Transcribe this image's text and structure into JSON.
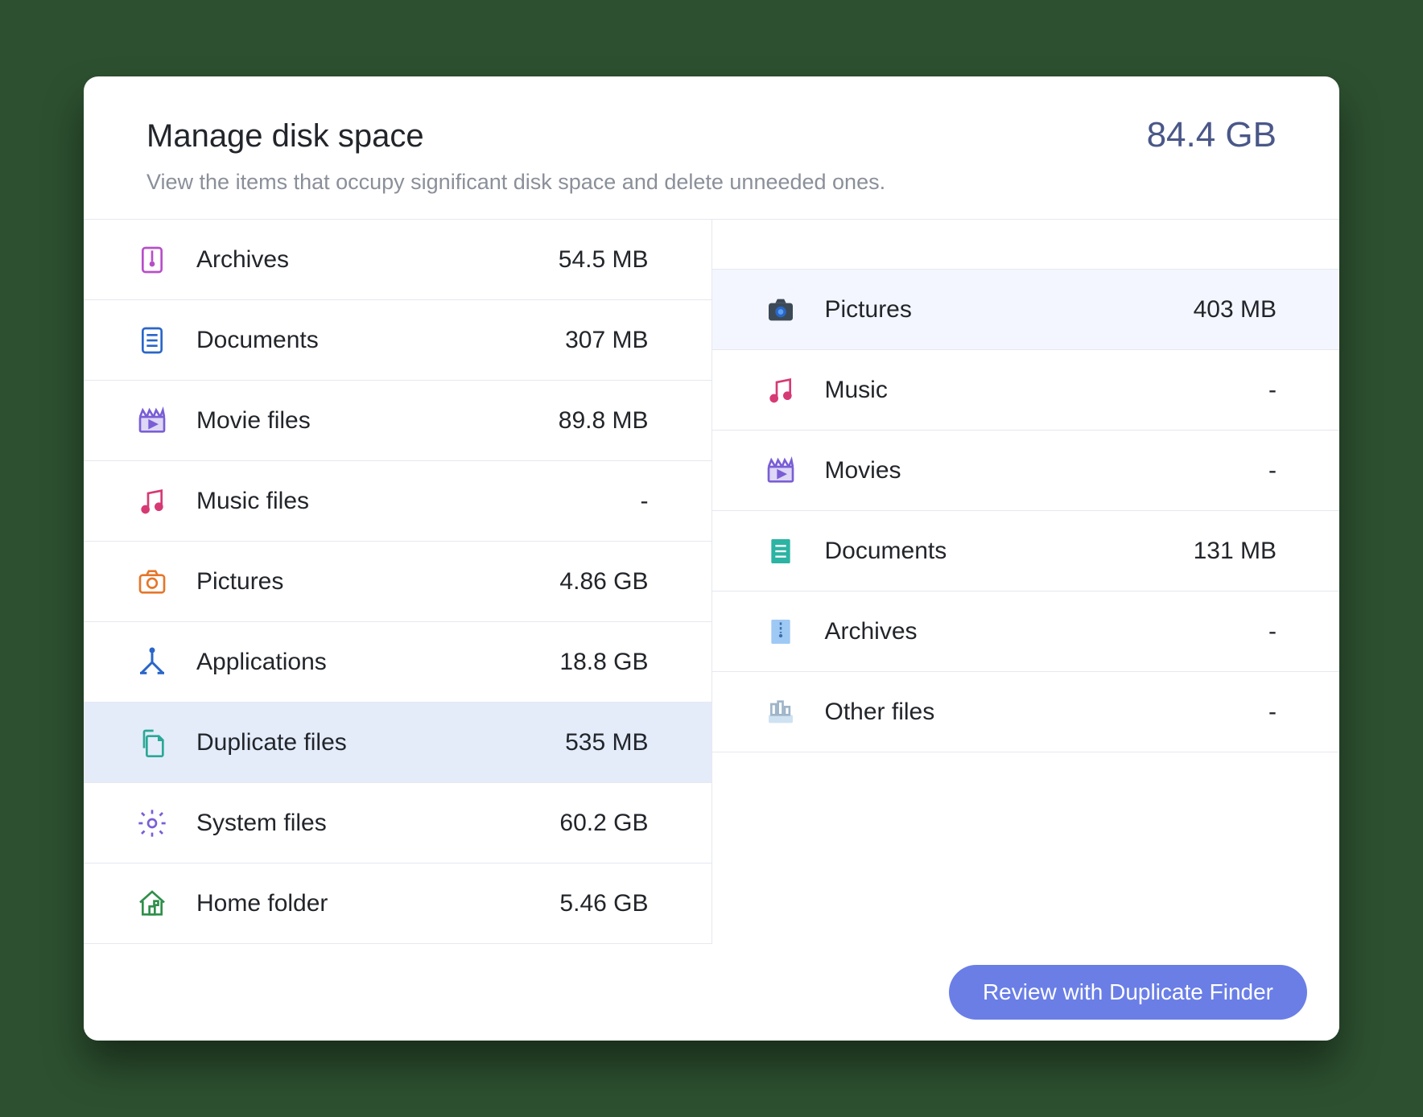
{
  "header": {
    "title": "Manage disk space",
    "total": "84.4 GB",
    "subtitle": "View the items that occupy significant disk space and delete unneeded ones."
  },
  "left": {
    "items": [
      {
        "label": "Archives",
        "size": "54.5 MB",
        "icon": "archive",
        "selected": false
      },
      {
        "label": "Documents",
        "size": "307 MB",
        "icon": "document",
        "selected": false
      },
      {
        "label": "Movie files",
        "size": "89.8 MB",
        "icon": "movie",
        "selected": false
      },
      {
        "label": "Music files",
        "size": "-",
        "icon": "music",
        "selected": false
      },
      {
        "label": "Pictures",
        "size": "4.86 GB",
        "icon": "camera-outline",
        "selected": false
      },
      {
        "label": "Applications",
        "size": "18.8 GB",
        "icon": "apps",
        "selected": false
      },
      {
        "label": "Duplicate files",
        "size": "535 MB",
        "icon": "duplicate",
        "selected": true
      },
      {
        "label": "System files",
        "size": "60.2 GB",
        "icon": "gear",
        "selected": false
      },
      {
        "label": "Home folder",
        "size": "5.46 GB",
        "icon": "home",
        "selected": false
      }
    ]
  },
  "right": {
    "items": [
      {
        "label": "Pictures",
        "size": "403 MB",
        "icon": "camera-solid",
        "selected": true
      },
      {
        "label": "Music",
        "size": "-",
        "icon": "music",
        "selected": false
      },
      {
        "label": "Movies",
        "size": "-",
        "icon": "movie",
        "selected": false
      },
      {
        "label": "Documents",
        "size": "131 MB",
        "icon": "document-teal",
        "selected": false
      },
      {
        "label": "Archives",
        "size": "-",
        "icon": "archive-blue",
        "selected": false
      },
      {
        "label": "Other files",
        "size": "-",
        "icon": "other",
        "selected": false
      }
    ]
  },
  "footer": {
    "action_label": "Review with Duplicate Finder"
  }
}
